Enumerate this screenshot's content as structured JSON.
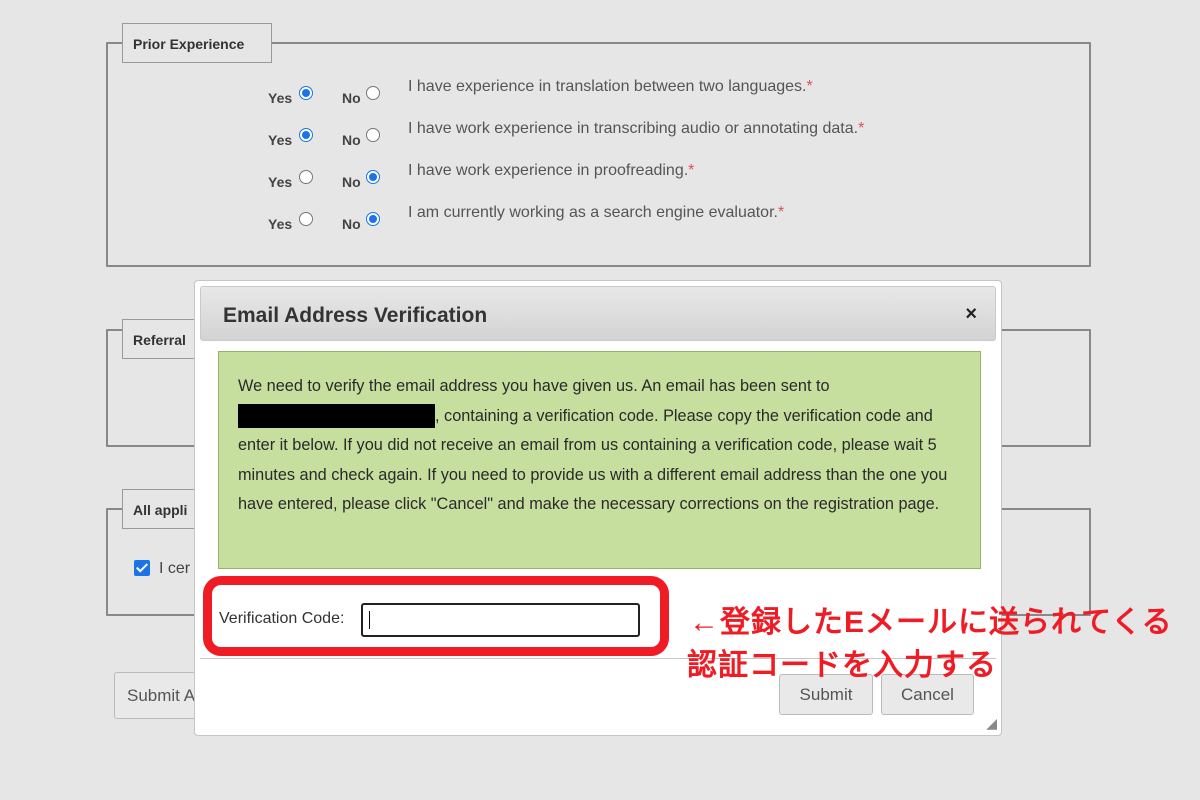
{
  "prior_experience": {
    "legend": "Prior Experience",
    "yes_label": "Yes",
    "no_label": "No",
    "required_mark": "*",
    "questions": [
      {
        "text": "I have experience in translation between two languages.",
        "answer": "Yes"
      },
      {
        "text": "I have work experience in transcribing audio or annotating data.",
        "answer": "Yes"
      },
      {
        "text": "I have work experience in proofreading.",
        "answer": "No"
      },
      {
        "text": "I am currently working as a search engine evaluator.",
        "answer": "No"
      }
    ]
  },
  "referral": {
    "legend": "Referral"
  },
  "all_applicants": {
    "legend": "All appli",
    "certify_text": "I cer",
    "certify_checked": true
  },
  "page_submit_label": "Submit A",
  "dialog": {
    "title": "Email Address Verification",
    "close_glyph": "×",
    "message_start": "We need to verify the email address you have given us. An email has been sent to ",
    "message_end": ", containing a verification code. Please copy the verification code and enter it below. If you did not receive an email from us containing a verification code, please wait 5 minutes and check again. If you need to provide us with a different email address than the one you have entered, please click \"Cancel\" and make the necessary corrections on the registration page.",
    "code_label": "Verification Code:",
    "code_value": "",
    "submit_label": "Submit",
    "cancel_label": "Cancel"
  },
  "annotation": {
    "line1": "←登録したEメールに送られてくる",
    "line2": "認証コードを入力する",
    "color": "#ef1c25"
  },
  "colors": {
    "notice_bg": "#c6de9e",
    "radio_accent": "#1a73e8",
    "required": "#d9534f"
  }
}
